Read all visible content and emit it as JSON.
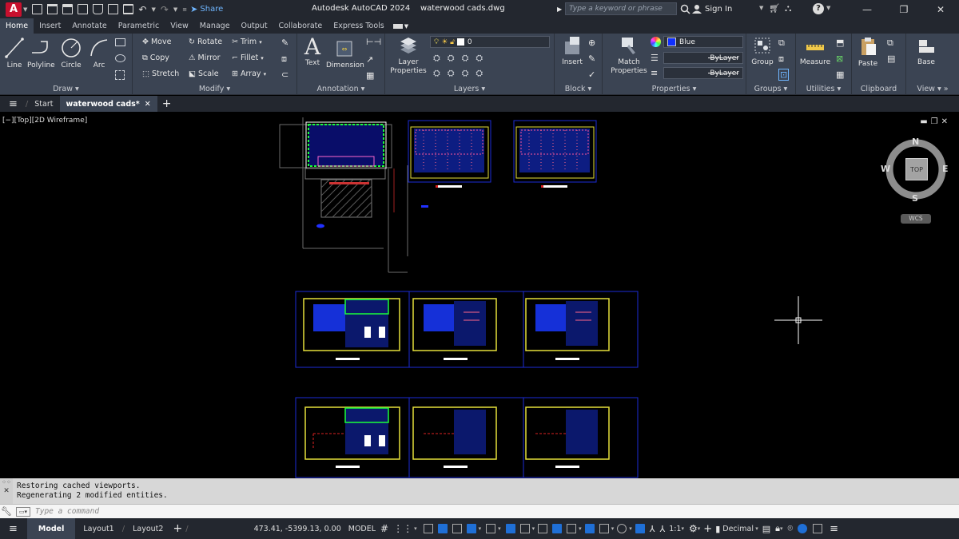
{
  "app": {
    "logo_letter": "A",
    "share_label": "Share",
    "title": "Autodesk AutoCAD 2024",
    "filename": "waterwood cads.dwg",
    "search_placeholder": "Type a keyword or phrase",
    "sign_in": "Sign In"
  },
  "tabs": [
    "Home",
    "Insert",
    "Annotate",
    "Parametric",
    "View",
    "Manage",
    "Output",
    "Collaborate",
    "Express Tools"
  ],
  "active_tab": "Home",
  "ribbon": {
    "draw": {
      "title": "Draw",
      "tools": [
        "Line",
        "Polyline",
        "Circle",
        "Arc"
      ]
    },
    "modify": {
      "title": "Modify",
      "tools": [
        "Move",
        "Rotate",
        "Trim",
        "Copy",
        "Mirror",
        "Fillet",
        "Stretch",
        "Scale",
        "Array"
      ]
    },
    "annotation": {
      "title": "Annotation",
      "tools": [
        "Text",
        "Dimension"
      ]
    },
    "layers": {
      "title": "Layers",
      "tools": [
        "Layer Properties"
      ],
      "current_layer": "0"
    },
    "block": {
      "title": "Block",
      "tools": [
        "Insert"
      ]
    },
    "properties": {
      "title": "Properties",
      "tools": [
        "Match Properties"
      ],
      "color": "Blue",
      "color_hex": "#1030ff",
      "linetype": "ByLayer",
      "lineweight": "ByLayer"
    },
    "groups": {
      "title": "Groups",
      "tools": [
        "Group"
      ]
    },
    "utilities": {
      "title": "Utilities",
      "tools": [
        "Measure"
      ]
    },
    "clipboard": {
      "title": "Clipboard",
      "tools": [
        "Paste"
      ]
    },
    "view": {
      "title": "View",
      "tools": [
        "Base"
      ]
    }
  },
  "file_tabs": [
    "Start",
    "waterwood cads*"
  ],
  "viewport": {
    "label": "[−][Top][2D Wireframe]",
    "viewcube": {
      "top": "TOP",
      "n": "N",
      "s": "S",
      "e": "E",
      "w": "W",
      "wcs": "WCS"
    }
  },
  "command": {
    "history": [
      "Restoring cached viewports.",
      "Regenerating 2 modified entities."
    ],
    "placeholder": "Type a command"
  },
  "status": {
    "layout_tabs": [
      "Model",
      "Layout1",
      "Layout2"
    ],
    "coords": "473.41, -5399.13, 0.00",
    "space": "MODEL",
    "scale": "1:1",
    "units": "Decimal"
  }
}
